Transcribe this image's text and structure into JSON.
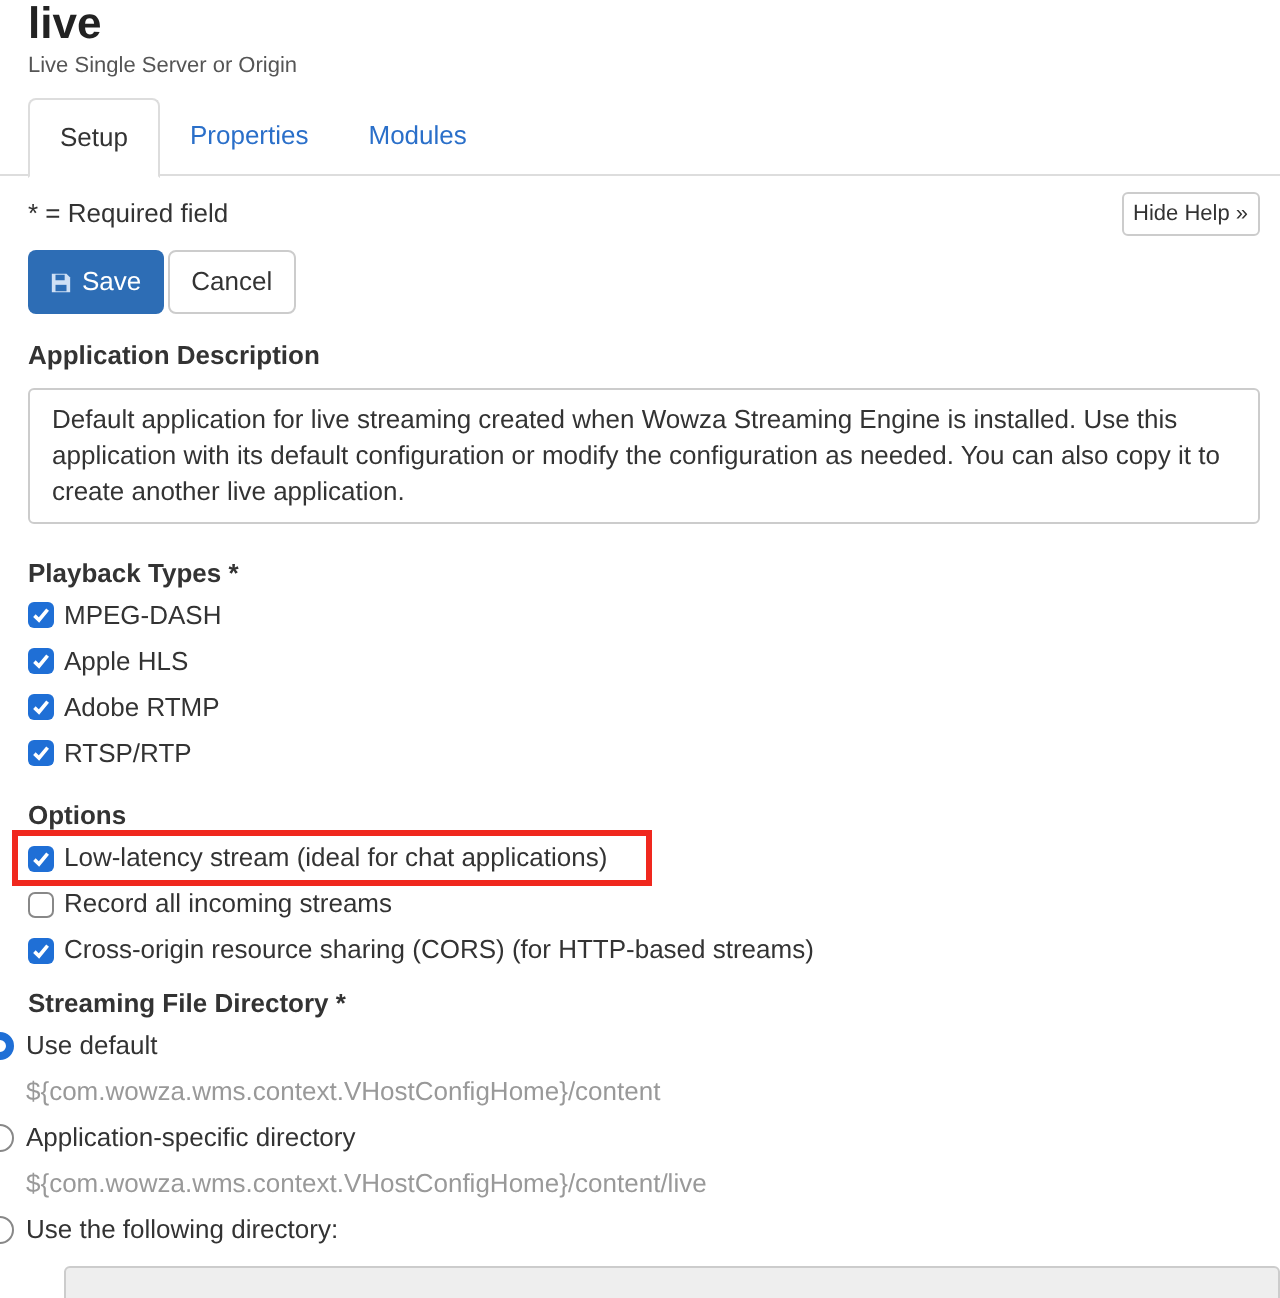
{
  "header": {
    "title": "live",
    "subtitle": "Live Single Server or Origin"
  },
  "tabs": [
    {
      "label": "Setup",
      "selected": true
    },
    {
      "label": "Properties",
      "selected": false
    },
    {
      "label": "Modules",
      "selected": false
    }
  ],
  "required_note": "* = Required field",
  "hide_help_button": "Hide Help »",
  "buttons": {
    "save": "Save",
    "cancel": "Cancel"
  },
  "description": {
    "label": "Application Description",
    "value": "Default application for live streaming created when Wowza Streaming Engine is installed. Use this application with its default configuration or modify the configuration as needed. You can also copy it to create another live application."
  },
  "playback_types": {
    "label": "Playback Types *",
    "items": [
      {
        "label": "MPEG-DASH",
        "checked": true
      },
      {
        "label": "Apple HLS",
        "checked": true
      },
      {
        "label": "Adobe RTMP",
        "checked": true
      },
      {
        "label": "RTSP/RTP",
        "checked": true
      }
    ]
  },
  "options": {
    "label": "Options",
    "items": [
      {
        "label": "Low-latency stream (ideal for chat applications)",
        "checked": true,
        "highlighted": true
      },
      {
        "label": "Record all incoming streams",
        "checked": false,
        "highlighted": false
      },
      {
        "label": "Cross-origin resource sharing (CORS) (for HTTP-based streams)",
        "checked": true,
        "highlighted": false
      }
    ]
  },
  "streaming_file_directory": {
    "label": "Streaming File Directory *",
    "choices": [
      {
        "label": "Use default",
        "selected": true,
        "path": "${com.wowza.wms.context.VHostConfigHome}/content"
      },
      {
        "label": "Application-specific directory",
        "selected": false,
        "path": "${com.wowza.wms.context.VHostConfigHome}/content/live"
      },
      {
        "label": "Use the following directory:",
        "selected": false
      }
    ]
  }
}
